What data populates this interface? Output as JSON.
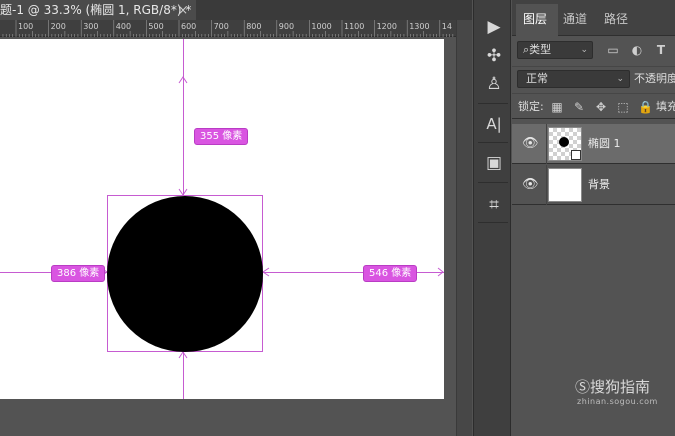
{
  "document": {
    "tab_title": "题-1 @ 33.3% (椭圆 1, RGB/8*) *",
    "close_symbol": "×"
  },
  "ruler": {
    "labels": [
      "100",
      "200",
      "300",
      "400",
      "500",
      "600",
      "700",
      "800",
      "900",
      "1000",
      "1100",
      "1200",
      "1300",
      "14"
    ]
  },
  "canvas": {
    "guide_color": "#c65bd1",
    "shape_color": "#000000",
    "measurements": {
      "top": "355 像素",
      "left": "386 像素",
      "right": "546 像素"
    }
  },
  "toolstrip": {
    "tools": [
      {
        "icon": "play-icon",
        "glyph": "▶"
      },
      {
        "icon": "puzzle-icon",
        "glyph": "✣"
      },
      {
        "icon": "person-icon",
        "glyph": "♙"
      },
      {
        "icon": "character-icon",
        "glyph": "A|"
      },
      {
        "icon": "cube-icon",
        "glyph": "▣"
      },
      {
        "icon": "crop-icon",
        "glyph": "⌗"
      }
    ]
  },
  "layers_panel": {
    "tabs": [
      "图层",
      "通道",
      "路径"
    ],
    "active_tab": "图层",
    "filter": {
      "value": "⌕类型"
    },
    "blend_mode": "正常",
    "opacity_label": "不透明度",
    "lock_label": "锁定:",
    "fill_label": "填充",
    "layers": [
      {
        "name": "椭圆 1",
        "visible": true,
        "selected": true,
        "thumb": "checker"
      },
      {
        "name": "背景",
        "visible": true,
        "selected": false,
        "thumb": "white"
      }
    ]
  },
  "watermark": {
    "text": "Ⓢ搜狗指南",
    "url": "zhinan.sogou.com"
  }
}
